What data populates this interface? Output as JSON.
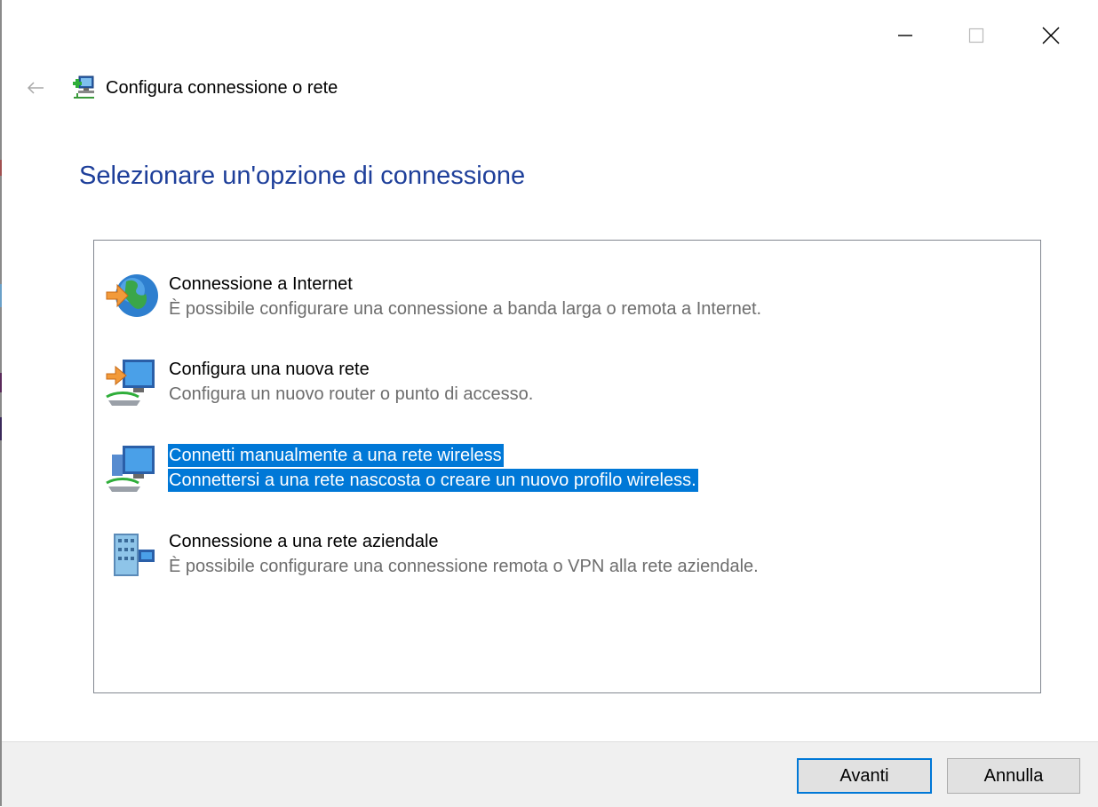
{
  "window": {
    "title": "Configura connessione o rete",
    "controls": {
      "minimize_icon": "minimize-icon",
      "maximize_icon": "maximize-icon",
      "close_icon": "close-icon"
    }
  },
  "header": {
    "back_icon": "back-arrow-icon",
    "heading": "Selezionare un'opzione di connessione"
  },
  "options": [
    {
      "title": "Connessione a Internet",
      "description": "È possibile configurare una connessione a banda larga o remota a Internet.",
      "icon": "globe-internet-icon",
      "selected": false
    },
    {
      "title": "Configura una nuova rete",
      "description": "Configura un nuovo router o punto di accesso.",
      "icon": "new-network-icon",
      "selected": false
    },
    {
      "title": "Connetti manualmente a una rete wireless",
      "description": "Connettersi a una rete nascosta o creare un nuovo profilo wireless.",
      "icon": "wireless-network-icon",
      "selected": true
    },
    {
      "title": "Connessione a una rete aziendale",
      "description": "È possibile configurare una connessione remota o VPN alla rete aziendale.",
      "icon": "workplace-vpn-icon",
      "selected": false
    }
  ],
  "buttons": {
    "next": "Avanti",
    "cancel": "Annulla"
  },
  "colors": {
    "accent": "#0078d7",
    "heading": "#1e3f9a",
    "description": "#6d6d6d"
  }
}
